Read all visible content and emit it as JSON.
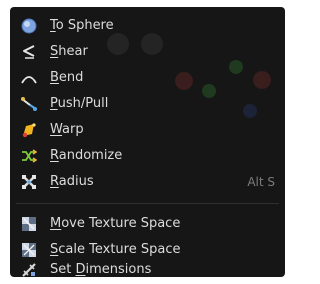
{
  "menu": {
    "items": [
      {
        "pre": "",
        "ul": "T",
        "post": "o Sphere",
        "icon": "to-sphere-icon",
        "shortcut": ""
      },
      {
        "pre": "",
        "ul": "S",
        "post": "hear",
        "icon": "shear-icon",
        "shortcut": ""
      },
      {
        "pre": "",
        "ul": "B",
        "post": "end",
        "icon": "bend-icon",
        "shortcut": ""
      },
      {
        "pre": "",
        "ul": "P",
        "post": "ush/Pull",
        "icon": "push-pull-icon",
        "shortcut": ""
      },
      {
        "pre": "",
        "ul": "W",
        "post": "arp",
        "icon": "warp-icon",
        "shortcut": ""
      },
      {
        "pre": "",
        "ul": "R",
        "post": "andomize",
        "icon": "randomize-icon",
        "shortcut": ""
      },
      {
        "pre": "",
        "ul": "R",
        "post": "adius",
        "icon": "radius-icon",
        "shortcut": "Alt S"
      }
    ],
    "items2": [
      {
        "pre": "",
        "ul": "M",
        "post": "ove Texture Space",
        "icon": "move-texture-space-icon",
        "shortcut": ""
      },
      {
        "pre": "",
        "ul": "S",
        "post": "cale Texture Space",
        "icon": "scale-texture-space-icon",
        "shortcut": ""
      },
      {
        "pre": "Set ",
        "ul": "D",
        "post": "imensions",
        "icon": "set-dimensions-icon",
        "shortcut": ""
      }
    ]
  },
  "colors": {
    "menu_bg": "#161616",
    "text": "#dcdcdc",
    "shortcut": "#7c7c7c"
  }
}
